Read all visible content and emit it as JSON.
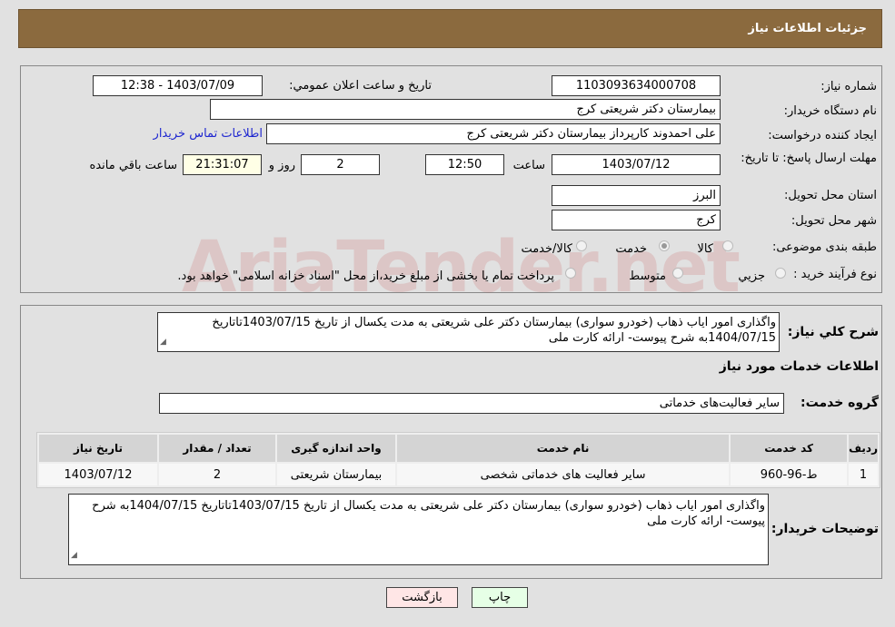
{
  "header": {
    "title": "جزئیات اطلاعات نیاز"
  },
  "watermark": "AriaTender.net",
  "fields": {
    "need_number_label": "شماره نیاز:",
    "need_number": "1103093634000708",
    "announce_label": "تاریخ و ساعت اعلان عمومي:",
    "announce_value": "1403/07/09 - 12:38",
    "buyer_org_label": "نام دستگاه خریدار:",
    "buyer_org": "بیمارستان دکتر شریعتی کرج",
    "creator_label": "ایجاد کننده درخواست:",
    "creator": "علی احمدوند کارپرداز بیمارستان دکتر شریعتی کرج",
    "contact_link": "اطلاعات تماس خریدار",
    "deadline_label": "مهلت ارسال پاسخ: تا تاریخ:",
    "deadline_date": "1403/07/12",
    "time_label": "ساعت",
    "deadline_time": "12:50",
    "days": "2",
    "days_label": "روز و",
    "remaining": "21:31:07",
    "remaining_label": "ساعت باقي مانده",
    "province_label": "استان محل تحویل:",
    "province": "البرز",
    "city_label": "شهر محل تحویل:",
    "city": "کرج",
    "category_label": "طبقه بندی موضوعی:",
    "category_options": [
      "کالا",
      "خدمت",
      "کالا/خدمت"
    ],
    "category_selected": "خدمت",
    "process_label": "نوع فرآیند خرید :",
    "process_options": [
      "جزیي",
      "متوسط"
    ],
    "process_note": "پرداخت تمام یا بخشی از مبلغ خرید،از محل \"اسناد خزانه اسلامی\" خواهد بود."
  },
  "details": {
    "summary_label": "شرح کلي نیاز:",
    "summary": "واگذاری امور اياب ذهاب (خودرو سواری) بیمارستان دکتر علی شریعتی به مدت یکسال از تاریخ 1403/07/15تاتاریخ 1404/07/15به شرح پیوست- ارائه کارت ملی",
    "services_title": "اطلاعات خدمات مورد نیاز",
    "group_label": "گروه خدمت:",
    "group": "سایر فعالیت‌های خدماتی",
    "table": {
      "headers": [
        "ردیف",
        "کد خدمت",
        "نام خدمت",
        "واحد اندازه گیری",
        "تعداد / مقدار",
        "تاریخ نیاز"
      ],
      "rows": [
        [
          "1",
          "ط-96-960",
          "سایر فعالیت های خدماتی شخصی",
          "بیمارستان شریعتی",
          "2",
          "1403/07/12"
        ]
      ]
    },
    "buyer_notes_label": "توضیحات خریدار:",
    "buyer_notes": "واگذاری امور اياب ذهاب (خودرو سواری) بیمارستان دکتر علی شریعتی به مدت یکسال از تاریخ 1403/07/15تاتاریخ 1404/07/15به شرح پیوست- ارائه کارت ملی"
  },
  "buttons": {
    "back": "بازگشت",
    "print": "چاپ"
  }
}
